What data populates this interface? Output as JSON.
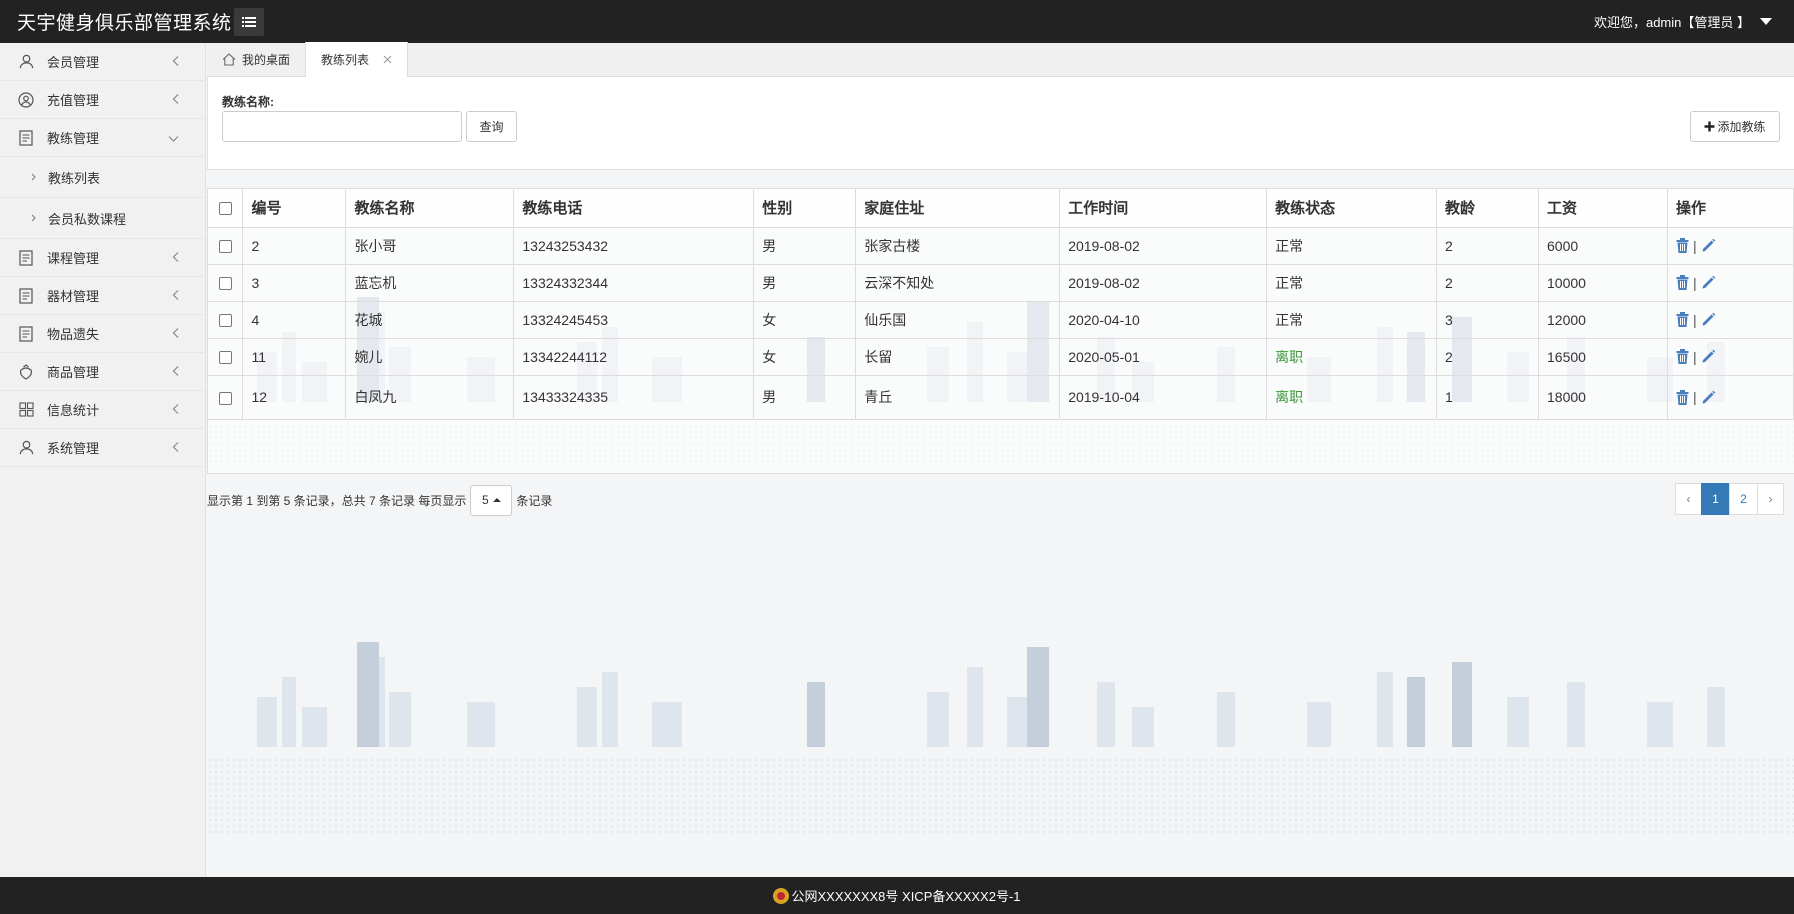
{
  "header": {
    "title": "天宇健身俱乐部管理系统",
    "user_text": "欢迎您，admin【管理员 】"
  },
  "sidebar": {
    "items": [
      {
        "label": "会员管理",
        "icon": "user-icon"
      },
      {
        "label": "充值管理",
        "icon": "user-circle-icon"
      },
      {
        "label": "教练管理",
        "icon": "document-icon",
        "expanded": true
      },
      {
        "label": "课程管理",
        "icon": "document-icon"
      },
      {
        "label": "器材管理",
        "icon": "document-icon"
      },
      {
        "label": "物品遗失",
        "icon": "document-icon"
      },
      {
        "label": "商品管理",
        "icon": "bag-icon"
      },
      {
        "label": "信息统计",
        "icon": "grid-icon"
      },
      {
        "label": "系统管理",
        "icon": "user-icon"
      }
    ],
    "subitems": [
      {
        "label": "教练列表"
      },
      {
        "label": "会员私数课程"
      }
    ]
  },
  "tabs": {
    "home": "我的桌面",
    "current": "教练列表"
  },
  "search": {
    "label": "教练名称:",
    "value": "",
    "query_button": "查询",
    "add_button": "添加教练"
  },
  "table": {
    "headers": [
      "编号",
      "教练名称",
      "教练电话",
      "性别",
      "家庭住址",
      "工作时间",
      "教练状态",
      "教龄",
      "工资",
      "操作"
    ],
    "rows": [
      {
        "id": "2",
        "name": "张小哥",
        "phone": "13243253432",
        "gender": "男",
        "address": "张家古楼",
        "date": "2019-08-02",
        "status": "正常",
        "status_color": "#333333",
        "years": "2",
        "salary": "6000"
      },
      {
        "id": "3",
        "name": "蓝忘机",
        "phone": "13324332344",
        "gender": "男",
        "address": "云深不知处",
        "date": "2019-08-02",
        "status": "正常",
        "status_color": "#333333",
        "years": "2",
        "salary": "10000"
      },
      {
        "id": "4",
        "name": "花城",
        "phone": "13324245453",
        "gender": "女",
        "address": "仙乐国",
        "date": "2020-04-10",
        "status": "正常",
        "status_color": "#333333",
        "years": "3",
        "salary": "12000"
      },
      {
        "id": "11",
        "name": "婉儿",
        "phone": "13342244112",
        "gender": "女",
        "address": "长留",
        "date": "2020-05-01",
        "status": "离职",
        "status_color": "#3c9a3c",
        "years": "2",
        "salary": "16500"
      },
      {
        "id": "12",
        "name": "白凤九",
        "phone": "13433324335",
        "gender": "男",
        "address": "青丘",
        "date": "2019-10-04",
        "status": "离职",
        "status_color": "#3c9a3c",
        "years": "1",
        "salary": "18000"
      }
    ],
    "op_separator": "|"
  },
  "pagination": {
    "info_before": "显示第 1 到第 5 条记录，总共 7 条记录 每页显示",
    "per_page": "5",
    "info_after": "条记录",
    "prev": "‹",
    "pages": [
      "1",
      "2"
    ],
    "current_page": "1",
    "next": "›"
  },
  "footer": {
    "text": "公网XXXXXXX8号 XICP备XXXXX2号-1"
  },
  "colors": {
    "topbar": "#222222",
    "primary": "#337ab7",
    "inactive_status": "#3c9a3c"
  }
}
